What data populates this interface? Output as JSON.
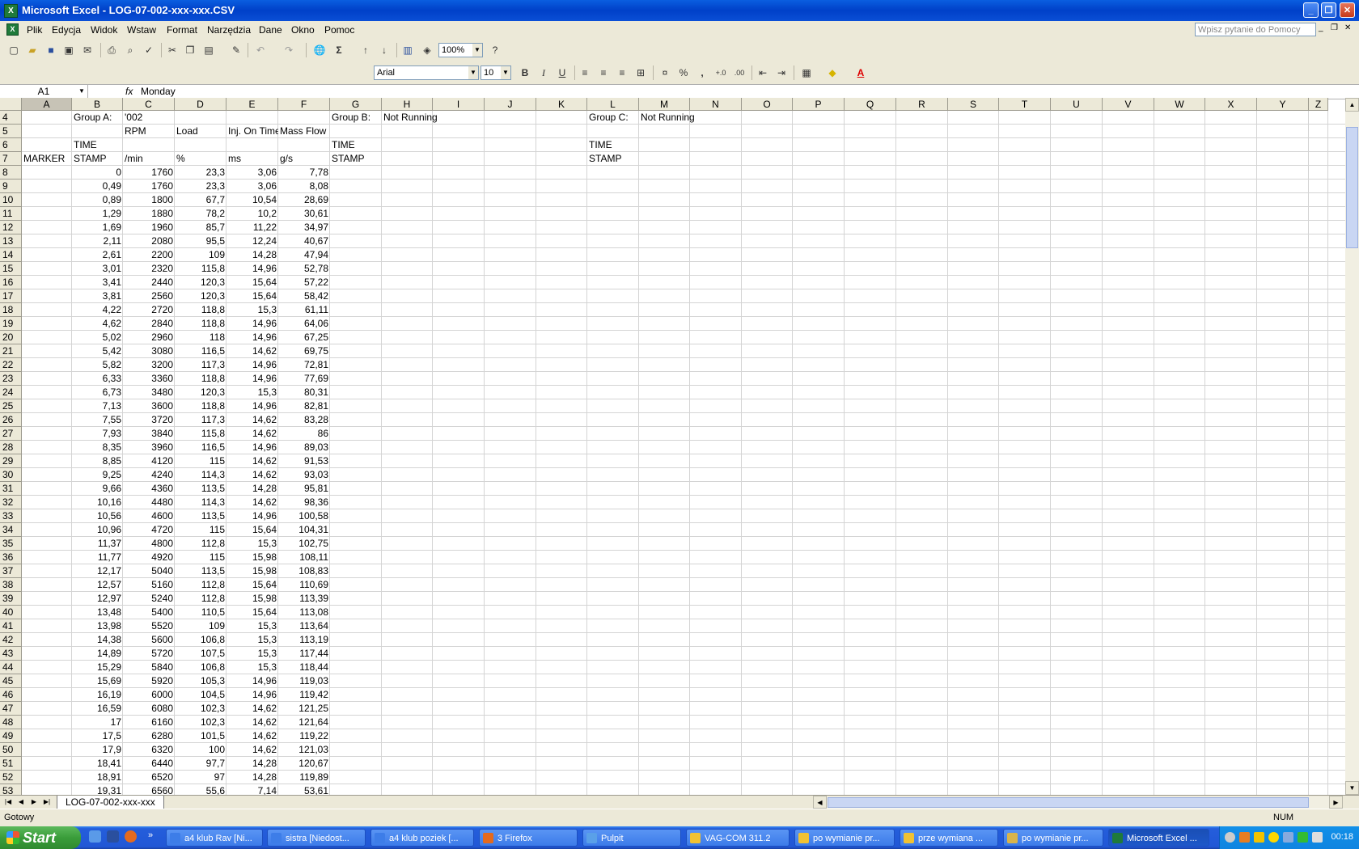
{
  "window": {
    "title": "Microsoft Excel - LOG-07-002-xxx-xxx.CSV",
    "btn_min": "_",
    "btn_max": "❐",
    "btn_close": "✕"
  },
  "menu": [
    {
      "label": "Plik"
    },
    {
      "label": "Edycja"
    },
    {
      "label": "Widok"
    },
    {
      "label": "Wstaw"
    },
    {
      "label": "Format"
    },
    {
      "label": "Narzędzia"
    },
    {
      "label": "Dane"
    },
    {
      "label": "Okno"
    },
    {
      "label": "Pomoc"
    }
  ],
  "help_placeholder": "Wpisz pytanie do Pomocy",
  "toolbar": {
    "zoom": "100%",
    "font": "Arial",
    "size": "10",
    "bold": "B",
    "italic": "I",
    "underline": "U",
    "percent": "%",
    "comma": ",",
    "autosum": "Σ"
  },
  "formula_bar": {
    "name_box": "A1",
    "fx": "fx",
    "formula": "Monday"
  },
  "columns": [
    "A",
    "B",
    "C",
    "D",
    "E",
    "F",
    "G",
    "H",
    "I",
    "J",
    "K",
    "L",
    "M",
    "N",
    "O",
    "P",
    "Q",
    "R",
    "S",
    "T",
    "U",
    "V",
    "W",
    "X",
    "Y",
    "Z"
  ],
  "row_numbers": [
    "4",
    "5",
    "6",
    "7",
    "8",
    "9",
    "10",
    "11",
    "12",
    "13",
    "14",
    "15",
    "16",
    "17",
    "18",
    "19",
    "20",
    "21",
    "22",
    "23",
    "24",
    "25",
    "26",
    "27",
    "28",
    "29",
    "30",
    "31",
    "32",
    "33",
    "34",
    "35",
    "36",
    "37",
    "38",
    "39",
    "40",
    "41",
    "42",
    "43",
    "44",
    "45",
    "46",
    "47",
    "48",
    "49",
    "50",
    "51",
    "52",
    "53"
  ],
  "header_rows": {
    "r4": {
      "B": "Group A:",
      "C": "'002",
      "G": "Group B:",
      "H": "Not Running",
      "L": "Group C:",
      "M": "Not Running"
    },
    "r5": {
      "C": "RPM",
      "D": "Load",
      "E": "Inj. On Time",
      "F": "Mass Flow"
    },
    "r6": {
      "B": "TIME",
      "G": "TIME",
      "L": "TIME"
    },
    "r7": {
      "A": "MARKER",
      "B": "STAMP",
      "C": "/min",
      "D": "%",
      "E": "ms",
      "F": "g/s",
      "G": "STAMP",
      "L": "STAMP"
    }
  },
  "data_rows": [
    [
      "0",
      "1760",
      "23,3",
      "3,06",
      "7,78"
    ],
    [
      "0,49",
      "1760",
      "23,3",
      "3,06",
      "8,08"
    ],
    [
      "0,89",
      "1800",
      "67,7",
      "10,54",
      "28,69"
    ],
    [
      "1,29",
      "1880",
      "78,2",
      "10,2",
      "30,61"
    ],
    [
      "1,69",
      "1960",
      "85,7",
      "11,22",
      "34,97"
    ],
    [
      "2,11",
      "2080",
      "95,5",
      "12,24",
      "40,67"
    ],
    [
      "2,61",
      "2200",
      "109",
      "14,28",
      "47,94"
    ],
    [
      "3,01",
      "2320",
      "115,8",
      "14,96",
      "52,78"
    ],
    [
      "3,41",
      "2440",
      "120,3",
      "15,64",
      "57,22"
    ],
    [
      "3,81",
      "2560",
      "120,3",
      "15,64",
      "58,42"
    ],
    [
      "4,22",
      "2720",
      "118,8",
      "15,3",
      "61,11"
    ],
    [
      "4,62",
      "2840",
      "118,8",
      "14,96",
      "64,06"
    ],
    [
      "5,02",
      "2960",
      "118",
      "14,96",
      "67,25"
    ],
    [
      "5,42",
      "3080",
      "116,5",
      "14,62",
      "69,75"
    ],
    [
      "5,82",
      "3200",
      "117,3",
      "14,96",
      "72,81"
    ],
    [
      "6,33",
      "3360",
      "118,8",
      "14,96",
      "77,69"
    ],
    [
      "6,73",
      "3480",
      "120,3",
      "15,3",
      "80,31"
    ],
    [
      "7,13",
      "3600",
      "118,8",
      "14,96",
      "82,81"
    ],
    [
      "7,55",
      "3720",
      "117,3",
      "14,62",
      "83,28"
    ],
    [
      "7,93",
      "3840",
      "115,8",
      "14,62",
      "86"
    ],
    [
      "8,35",
      "3960",
      "116,5",
      "14,96",
      "89,03"
    ],
    [
      "8,85",
      "4120",
      "115",
      "14,62",
      "91,53"
    ],
    [
      "9,25",
      "4240",
      "114,3",
      "14,62",
      "93,03"
    ],
    [
      "9,66",
      "4360",
      "113,5",
      "14,28",
      "95,81"
    ],
    [
      "10,16",
      "4480",
      "114,3",
      "14,62",
      "98,36"
    ],
    [
      "10,56",
      "4600",
      "113,5",
      "14,96",
      "100,58"
    ],
    [
      "10,96",
      "4720",
      "115",
      "15,64",
      "104,31"
    ],
    [
      "11,37",
      "4800",
      "112,8",
      "15,3",
      "102,75"
    ],
    [
      "11,77",
      "4920",
      "115",
      "15,98",
      "108,11"
    ],
    [
      "12,17",
      "5040",
      "113,5",
      "15,98",
      "108,83"
    ],
    [
      "12,57",
      "5160",
      "112,8",
      "15,64",
      "110,69"
    ],
    [
      "12,97",
      "5240",
      "112,8",
      "15,98",
      "113,39"
    ],
    [
      "13,48",
      "5400",
      "110,5",
      "15,64",
      "113,08"
    ],
    [
      "13,98",
      "5520",
      "109",
      "15,3",
      "113,64"
    ],
    [
      "14,38",
      "5600",
      "106,8",
      "15,3",
      "113,19"
    ],
    [
      "14,89",
      "5720",
      "107,5",
      "15,3",
      "117,44"
    ],
    [
      "15,29",
      "5840",
      "106,8",
      "15,3",
      "118,44"
    ],
    [
      "15,69",
      "5920",
      "105,3",
      "14,96",
      "119,03"
    ],
    [
      "16,19",
      "6000",
      "104,5",
      "14,96",
      "119,42"
    ],
    [
      "16,59",
      "6080",
      "102,3",
      "14,62",
      "121,25"
    ],
    [
      "17",
      "6160",
      "102,3",
      "14,62",
      "121,64"
    ],
    [
      "17,5",
      "6280",
      "101,5",
      "14,62",
      "119,22"
    ],
    [
      "17,9",
      "6320",
      "100",
      "14,62",
      "121,03"
    ],
    [
      "18,41",
      "6440",
      "97,7",
      "14,28",
      "120,67"
    ],
    [
      "18,91",
      "6520",
      "97",
      "14,28",
      "119,89"
    ],
    [
      "19,31",
      "6560",
      "55,6",
      "7,14",
      "53,61"
    ]
  ],
  "sheet_tab": "LOG-07-002-xxx-xxx",
  "status": {
    "ready": "Gotowy",
    "num": "NUM"
  },
  "taskbar": {
    "start": "Start",
    "tasks": [
      {
        "label": "a4 klub Rav [Ni...",
        "color": "#3d7de8"
      },
      {
        "label": "sistra [Niedost...",
        "color": "#3d7de8"
      },
      {
        "label": "a4 klub poziek [...",
        "color": "#3d7de8"
      },
      {
        "label": "3 Firefox",
        "color": "#e46a1e"
      },
      {
        "label": "Pulpit",
        "color": "#5aa0e8"
      },
      {
        "label": "VAG-COM 311.2",
        "color": "#f1c232"
      },
      {
        "label": "po wymianie pr...",
        "color": "#f1c232"
      },
      {
        "label": "prze wymiana ...",
        "color": "#f1c232"
      },
      {
        "label": "po wymianie pr...",
        "color": "#d9b44a"
      },
      {
        "label": "Microsoft Excel ...",
        "color": "#1f7a3a"
      }
    ],
    "clock": "00:18"
  }
}
